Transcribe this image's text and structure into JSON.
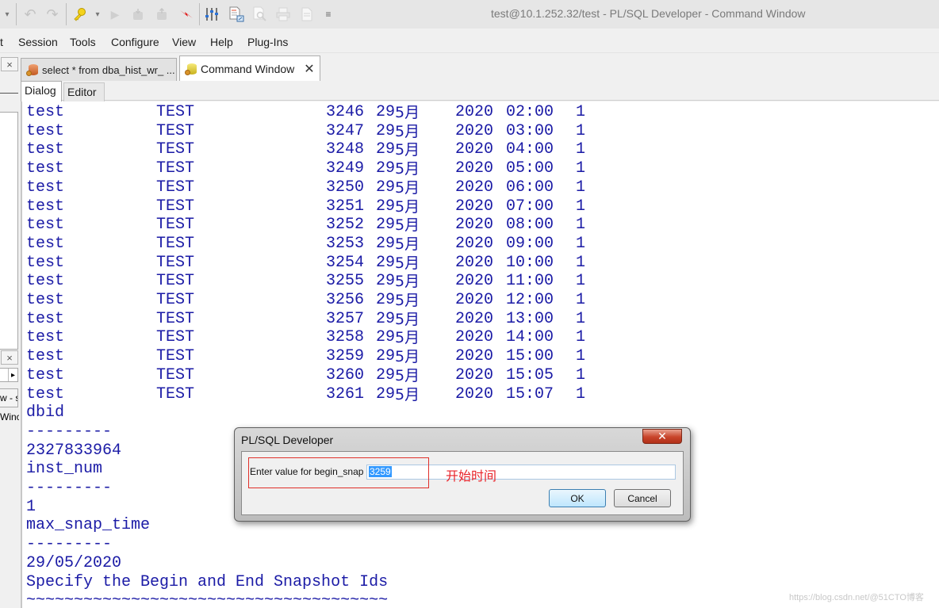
{
  "window": {
    "title": "test@10.1.252.32/test - PL/SQL Developer - Command Window"
  },
  "toolbar": {
    "items": [
      {
        "name": "dropdown-arrow-icon",
        "glyph": "▾",
        "enabled": true
      },
      {
        "name": "undo-icon",
        "glyph": "↶",
        "enabled": false
      },
      {
        "name": "redo-icon",
        "glyph": "↷",
        "enabled": false
      },
      {
        "name": "key-icon",
        "glyph": "🔑",
        "enabled": true
      },
      {
        "name": "key-dropdown-icon",
        "glyph": "▾",
        "enabled": true
      },
      {
        "name": "execute-icon",
        "glyph": "▶",
        "enabled": false
      },
      {
        "name": "commit-icon",
        "glyph": "⛁",
        "enabled": false
      },
      {
        "name": "rollback-icon",
        "glyph": "⛁",
        "enabled": false
      },
      {
        "name": "break-icon",
        "glyph": "⚡",
        "enabled": true
      },
      {
        "name": "sliders-icon",
        "glyph": "⫶",
        "enabled": true
      },
      {
        "name": "report-icon",
        "glyph": "📄",
        "enabled": true
      },
      {
        "name": "find-icon",
        "glyph": "🔍",
        "enabled": false
      },
      {
        "name": "print-icon",
        "glyph": "⎙",
        "enabled": false
      },
      {
        "name": "page-icon",
        "glyph": "🗎",
        "enabled": false
      },
      {
        "name": "overflow-icon",
        "glyph": "≡",
        "enabled": true
      }
    ]
  },
  "menu": {
    "items": [
      "t",
      "Session",
      "Tools",
      "Configure",
      "View",
      "Help",
      "Plug-Ins"
    ]
  },
  "left_panel": {
    "close_glyph": "×",
    "arrow_glyph": "▸",
    "text_1": "w - s",
    "text_2": "Winc"
  },
  "tabs": [
    {
      "label": "select * from dba_hist_wr_ ...",
      "active": false
    },
    {
      "label": "Command Window",
      "active": true,
      "close_glyph": "✕"
    }
  ],
  "subtabs": [
    {
      "label": "Dialog",
      "active": true
    },
    {
      "label": "Editor",
      "active": false
    }
  ],
  "console": {
    "rows": [
      {
        "c1": "test",
        "c2": "TEST",
        "snap": "3246",
        "day": "29",
        "month": "5月",
        "year": "2020",
        "time": "02:00",
        "inst": "1"
      },
      {
        "c1": "test",
        "c2": "TEST",
        "snap": "3247",
        "day": "29",
        "month": "5月",
        "year": "2020",
        "time": "03:00",
        "inst": "1"
      },
      {
        "c1": "test",
        "c2": "TEST",
        "snap": "3248",
        "day": "29",
        "month": "5月",
        "year": "2020",
        "time": "04:00",
        "inst": "1"
      },
      {
        "c1": "test",
        "c2": "TEST",
        "snap": "3249",
        "day": "29",
        "month": "5月",
        "year": "2020",
        "time": "05:00",
        "inst": "1"
      },
      {
        "c1": "test",
        "c2": "TEST",
        "snap": "3250",
        "day": "29",
        "month": "5月",
        "year": "2020",
        "time": "06:00",
        "inst": "1"
      },
      {
        "c1": "test",
        "c2": "TEST",
        "snap": "3251",
        "day": "29",
        "month": "5月",
        "year": "2020",
        "time": "07:00",
        "inst": "1"
      },
      {
        "c1": "test",
        "c2": "TEST",
        "snap": "3252",
        "day": "29",
        "month": "5月",
        "year": "2020",
        "time": "08:00",
        "inst": "1"
      },
      {
        "c1": "test",
        "c2": "TEST",
        "snap": "3253",
        "day": "29",
        "month": "5月",
        "year": "2020",
        "time": "09:00",
        "inst": "1"
      },
      {
        "c1": "test",
        "c2": "TEST",
        "snap": "3254",
        "day": "29",
        "month": "5月",
        "year": "2020",
        "time": "10:00",
        "inst": "1"
      },
      {
        "c1": "test",
        "c2": "TEST",
        "snap": "3255",
        "day": "29",
        "month": "5月",
        "year": "2020",
        "time": "11:00",
        "inst": "1"
      },
      {
        "c1": "test",
        "c2": "TEST",
        "snap": "3256",
        "day": "29",
        "month": "5月",
        "year": "2020",
        "time": "12:00",
        "inst": "1"
      },
      {
        "c1": "test",
        "c2": "TEST",
        "snap": "3257",
        "day": "29",
        "month": "5月",
        "year": "2020",
        "time": "13:00",
        "inst": "1"
      },
      {
        "c1": "test",
        "c2": "TEST",
        "snap": "3258",
        "day": "29",
        "month": "5月",
        "year": "2020",
        "time": "14:00",
        "inst": "1"
      },
      {
        "c1": "test",
        "c2": "TEST",
        "snap": "3259",
        "day": "29",
        "month": "5月",
        "year": "2020",
        "time": "15:00",
        "inst": "1"
      },
      {
        "c1": "test",
        "c2": "TEST",
        "snap": "3260",
        "day": "29",
        "month": "5月",
        "year": "2020",
        "time": "15:05",
        "inst": "1"
      },
      {
        "c1": "test",
        "c2": "TEST",
        "snap": "3261",
        "day": "29",
        "month": "5月",
        "year": "2020",
        "time": "15:07",
        "inst": "1"
      }
    ],
    "lines": [
      "dbid",
      "---------",
      "2327833964",
      "inst_num",
      "---------",
      "1",
      "max_snap_time",
      "---------",
      "29/05/2020",
      "Specify the Begin and End Snapshot Ids",
      "~~~~~~~~~~~~~~~~~~~~~~~~~~~~~~~~~~~~~~"
    ]
  },
  "dialog": {
    "title": "PL/SQL Developer",
    "close_glyph": "✕",
    "label": "Enter value for begin_snap",
    "input_value": "3259",
    "annotation": "开始时间",
    "ok_label": "OK",
    "cancel_label": "Cancel"
  },
  "watermark": "https://blog.csdn.net/@51CTO博客",
  "colors": {
    "console_text": "#1b1ba6",
    "annotation": "#e8232a",
    "selection": "#3399ff"
  }
}
